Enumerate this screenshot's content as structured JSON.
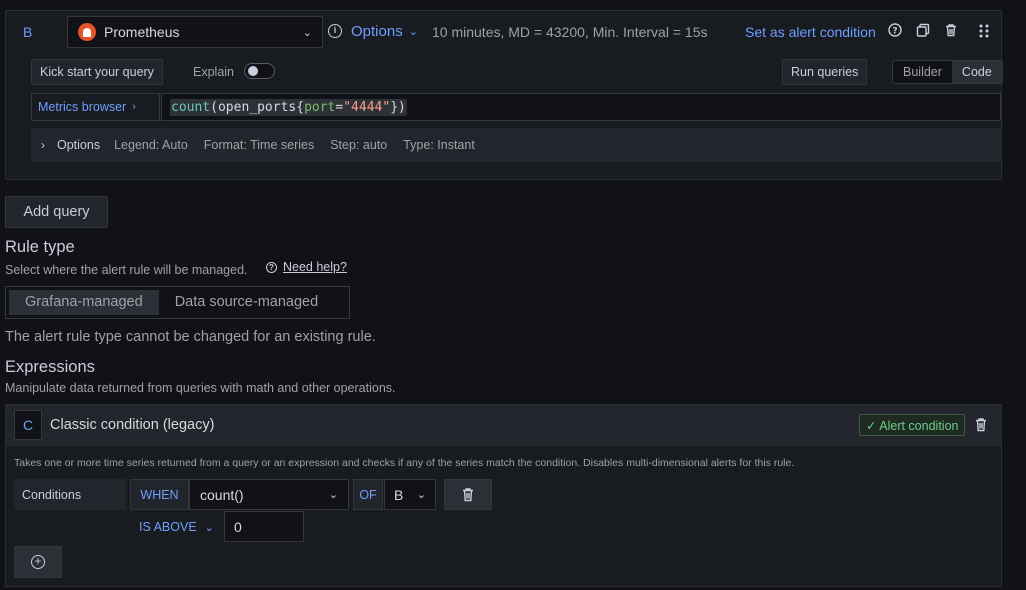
{
  "query": {
    "ref_id": "B",
    "datasource": "Prometheus",
    "options_label": "Options",
    "options_summary": "10 minutes, MD = 43200, Min. Interval = 15s",
    "alert_condition_link": "Set as alert condition",
    "kick_start_label": "Kick start your query",
    "explain_label": "Explain",
    "run_queries_label": "Run queries",
    "mode_builder": "Builder",
    "mode_code": "Code",
    "metrics_browser_label": "Metrics browser",
    "expr_tokens": {
      "fn": "count",
      "open": "(",
      "metric": "open_ports",
      "brace_open": "{",
      "label": "port",
      "eq": "=",
      "value": "\"4444\"",
      "close": "})"
    },
    "options_row": {
      "title": "Options",
      "legend": "Legend: Auto",
      "format": "Format: Time series",
      "step": "Step: auto",
      "type": "Type: Instant"
    }
  },
  "add_query_label": "Add query",
  "rule_type": {
    "heading": "Rule type",
    "subtitle": "Select where the alert rule will be managed.",
    "need_help": "Need help?",
    "options": [
      "Grafana-managed",
      "Data source-managed"
    ],
    "note": "The alert rule type cannot be changed for an existing rule."
  },
  "expressions": {
    "heading": "Expressions",
    "subtitle": "Manipulate data returned from queries with math and other operations.",
    "expr": {
      "ref_id": "C",
      "title": "Classic condition (legacy)",
      "alert_badge": "✓ Alert condition",
      "description": "Takes one or more time series returned from a query or an expression and checks if any of the series match the condition. Disables multi-dimensional alerts for this rule.",
      "conditions_label": "Conditions",
      "when_label": "WHEN",
      "reducer": "count()",
      "of_label": "OF",
      "query_ref": "B",
      "evaluator": "IS ABOVE",
      "threshold": "0"
    }
  }
}
